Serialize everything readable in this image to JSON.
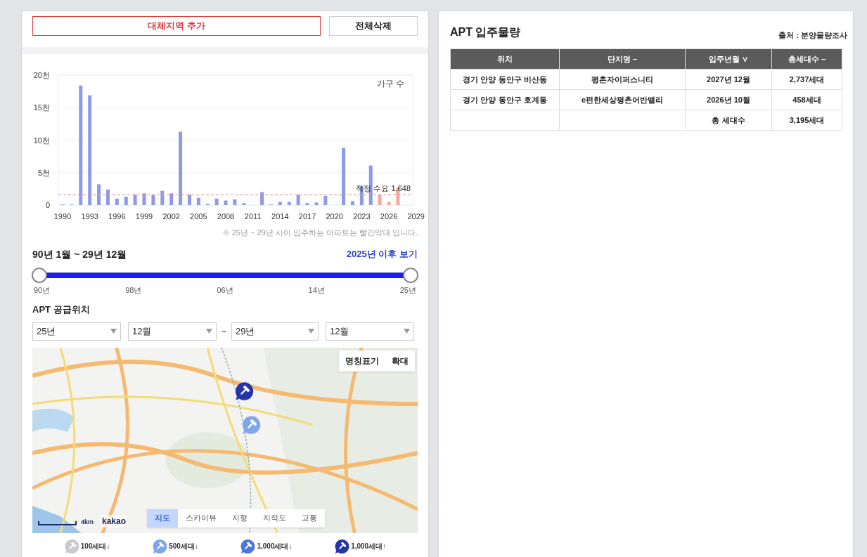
{
  "left_panel": {
    "buttons": [
      {
        "kind": "primary",
        "label": "대체지역 추가"
      },
      {
        "kind": "plain",
        "label": "전체삭제"
      }
    ],
    "chart": {
      "chart_data": {
        "type": "bar",
        "ylabel": "가구 수",
        "categories": [
          "1990",
          null,
          null,
          "1993",
          null,
          null,
          "1996",
          null,
          null,
          "1999",
          null,
          null,
          "2002",
          null,
          null,
          "2005",
          null,
          null,
          "2008",
          null,
          null,
          "2011",
          null,
          null,
          "2014",
          null,
          null,
          "2017",
          null,
          null,
          "2020",
          null,
          null,
          "2023",
          null,
          null,
          "2026",
          null,
          null,
          "2029"
        ],
        "series": [
          {
            "color": "#8b9bea",
            "values": [
              0.1,
              0.1,
              18.4,
              16.9,
              3.2,
              2.4,
              1.0,
              1.3,
              1.6,
              1.8,
              1.6,
              2.2,
              1.8,
              11.3,
              1.6,
              1.1,
              0.2,
              1.0,
              0.7,
              0.9,
              0.3,
              0,
              2.0,
              0.1,
              0.5,
              0.5,
              1.6,
              0.3,
              0.4,
              1.4,
              0,
              8.8,
              0.6,
              2.9,
              6.1,
              null,
              null,
              null,
              null,
              null
            ]
          },
          {
            "color": "#f3aa9c",
            "values": [
              null,
              null,
              null,
              null,
              null,
              null,
              null,
              null,
              null,
              null,
              null,
              null,
              null,
              null,
              null,
              null,
              null,
              null,
              null,
              null,
              null,
              null,
              null,
              null,
              null,
              null,
              null,
              null,
              null,
              null,
              null,
              null,
              null,
              null,
              null,
              1.6,
              0.5,
              2.7,
              0,
              0
            ]
          }
        ],
        "ylim": [
          0,
          20
        ],
        "yticks": [
          {
            "value": 0,
            "label": "0"
          },
          {
            "value": 5,
            "label": "5천"
          },
          {
            "value": 10,
            "label": "10천"
          },
          {
            "value": 15,
            "label": "15천"
          },
          {
            "value": 20,
            "label": "20천"
          }
        ],
        "grid": true,
        "ref_lines": [
          {
            "axis": "y",
            "value": 1.6,
            "label": "적정 수요 1,648"
          }
        ]
      },
      "note": "※ 25년 ~ 29년 사이 입주하는 아파트는 빨간막대 입니다."
    },
    "period": {
      "label": "90년 1월 ~ 29년 12월",
      "link": "2025년 이후 보기"
    },
    "slider": {
      "thumbs": [
        {
          "level": 0
        },
        {
          "level": 1
        }
      ],
      "ticks": [
        "90년",
        "98년",
        "06년",
        "14년",
        "25년"
      ]
    },
    "supply_location": {
      "title": "APT 공급위치",
      "selects": [
        {
          "value": "25년"
        },
        {
          "value": "12월"
        },
        {
          "value": "29년"
        },
        {
          "value": "12월"
        }
      ],
      "separator": "~"
    },
    "map": {
      "kind": "picture",
      "buttons": [
        "명칭표기",
        "확대"
      ],
      "map_types": [
        {
          "label": "지도",
          "selected": true
        },
        {
          "label": "스카이뷰",
          "selected": false
        },
        {
          "label": "지형",
          "selected": false
        },
        {
          "label": "지적도",
          "selected": false
        },
        {
          "label": "교통",
          "selected": false
        }
      ],
      "scale": "4km",
      "logo": "kakao"
    },
    "legend": [
      {
        "label": "100세대↓",
        "color": "#c9cad0"
      },
      {
        "label": "500세대↓",
        "color": "#7fa6ec"
      },
      {
        "label": "1,000세대↓",
        "color": "#4b78dc"
      },
      {
        "label": "1,000세대↑",
        "color": "#2535a8"
      }
    ]
  },
  "right_panel": {
    "title": "APT 입주물량",
    "source": "출처 : 분양물량조사",
    "table": {
      "columns": [
        "위치",
        "단지명 –",
        "입주년월 ∨",
        "총세대수 –"
      ],
      "rows": [
        [
          "경기 안양 동안구 비산동",
          "평촌자이퍼스니티",
          "2027년 12월",
          "2,737세대"
        ],
        [
          "경기 안양 동안구 호계동",
          "e편한세상평촌어반밸리",
          "2026년 10월",
          "458세대"
        ]
      ],
      "total": {
        "label": "총 세대수",
        "value": "3,195세대"
      }
    }
  }
}
